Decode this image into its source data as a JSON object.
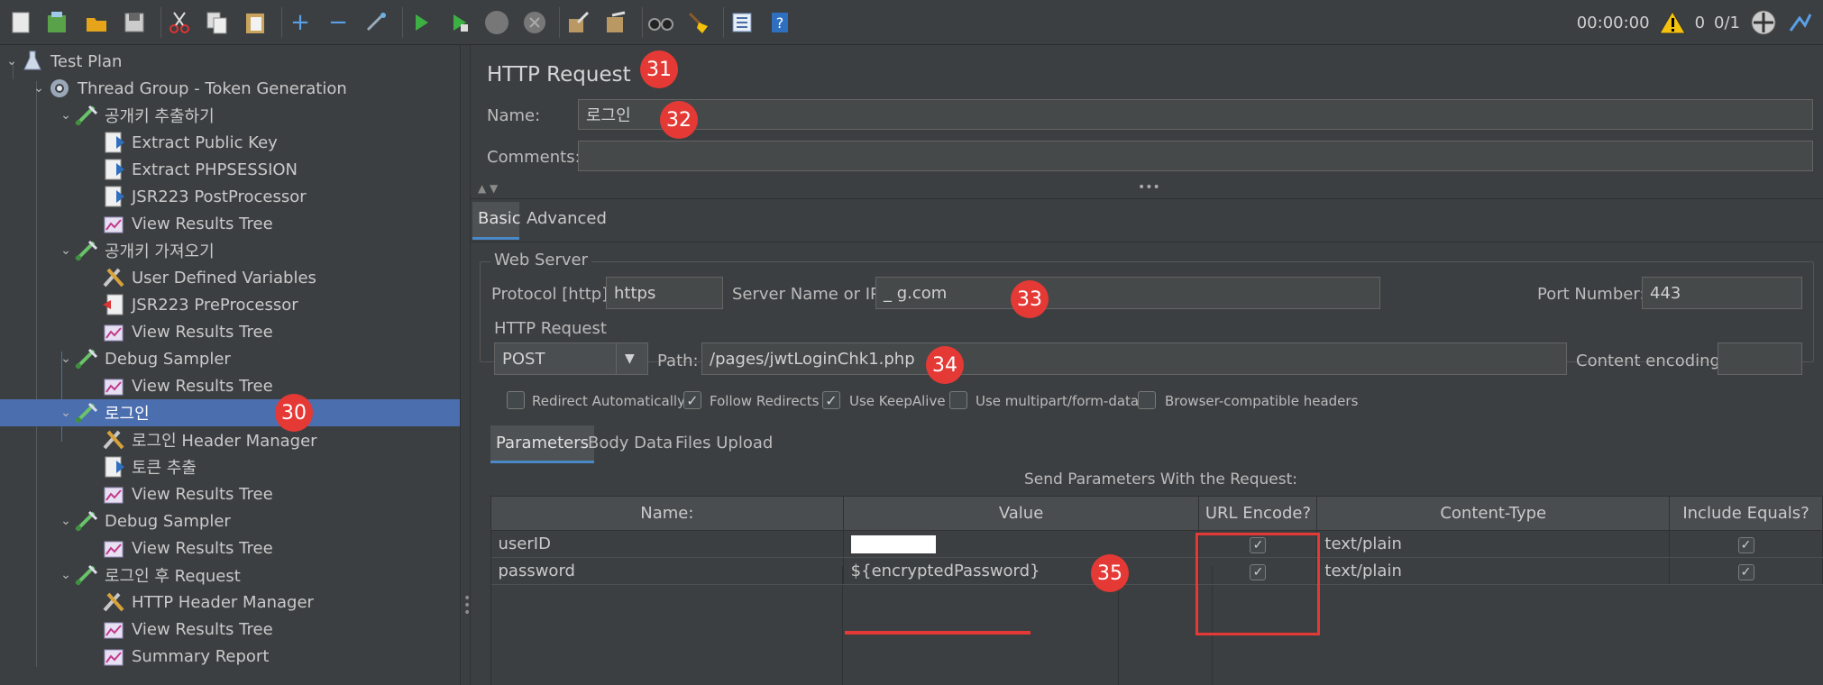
{
  "toolbar": {
    "icons": [
      "new-icon",
      "templates-icon",
      "open-icon",
      "save-icon",
      "cut-icon",
      "copy-icon",
      "paste-icon",
      "expand-icon",
      "collapse-icon",
      "toggle-icon",
      "start-icon",
      "start-no-pause-icon",
      "stop-icon",
      "shutdown-icon",
      "clear-icon",
      "clear-all-icon",
      "search-icon",
      "reset-search-icon",
      "function-helper-icon",
      "help-icon"
    ],
    "timer": "00:00:00",
    "warnings": "0",
    "threads": "0/1"
  },
  "tree": {
    "items": [
      {
        "label": "Test Plan",
        "icon": "test-plan-icon"
      },
      {
        "label": "Thread Group - Token Generation",
        "icon": "gear-icon"
      },
      {
        "label": "공개키 추출하기",
        "icon": "sampler-icon"
      },
      {
        "label": "Extract Public Key",
        "icon": "extractor-icon"
      },
      {
        "label": "Extract PHPSESSION",
        "icon": "extractor-icon"
      },
      {
        "label": "JSR223 PostProcessor",
        "icon": "postprocessor-icon"
      },
      {
        "label": "View Results Tree",
        "icon": "listener-icon"
      },
      {
        "label": "공개키 가져오기",
        "icon": "sampler-icon"
      },
      {
        "label": "User Defined Variables",
        "icon": "config-icon"
      },
      {
        "label": "JSR223 PreProcessor",
        "icon": "preprocessor-icon"
      },
      {
        "label": "View Results Tree",
        "icon": "listener-icon"
      },
      {
        "label": "Debug Sampler",
        "icon": "sampler-icon"
      },
      {
        "label": "View Results Tree",
        "icon": "listener-icon"
      },
      {
        "label": "로그인",
        "icon": "sampler-icon"
      },
      {
        "label": "로그인 Header Manager",
        "icon": "config-icon"
      },
      {
        "label": "토큰 추출",
        "icon": "extractor-icon"
      },
      {
        "label": "View Results Tree",
        "icon": "listener-icon"
      },
      {
        "label": "Debug Sampler",
        "icon": "sampler-icon"
      },
      {
        "label": "View Results Tree",
        "icon": "listener-icon"
      },
      {
        "label": "로그인 후 Request",
        "icon": "sampler-icon"
      },
      {
        "label": "HTTP Header Manager",
        "icon": "config-icon"
      },
      {
        "label": "View Results Tree",
        "icon": "listener-icon"
      },
      {
        "label": "Summary Report",
        "icon": "listener-icon"
      }
    ]
  },
  "annotations": {
    "b30": "30",
    "b31": "31",
    "b32": "32",
    "b33": "33",
    "b34": "34",
    "b35": "35"
  },
  "panel": {
    "title": "HTTP Request",
    "name_label": "Name:",
    "name_value": "로그인",
    "comments_label": "Comments:",
    "comments_value": "",
    "tabs": [
      "Basic",
      "Advanced"
    ],
    "web_server": {
      "legend": "Web Server",
      "protocol_label": "Protocol [http]:",
      "protocol_value": "https",
      "server_label": "Server Name or IP:",
      "server_value": "_          g.com",
      "port_label": "Port Number:",
      "port_value": "443"
    },
    "http_request": {
      "legend": "HTTP Request",
      "method": "POST",
      "path_label": "Path:",
      "path_value": "/pages/jwtLoginChk1.php",
      "encoding_label": "Content encoding:",
      "encoding_value": ""
    },
    "options": [
      {
        "label": "Redirect Automatically",
        "checked": false
      },
      {
        "label": "Follow Redirects",
        "checked": true
      },
      {
        "label": "Use KeepAlive",
        "checked": true
      },
      {
        "label": "Use multipart/form-data",
        "checked": false
      },
      {
        "label": "Browser-compatible headers",
        "checked": false
      }
    ],
    "subtabs": [
      "Parameters",
      "Body Data",
      "Files Upload"
    ],
    "params_caption": "Send Parameters With the Request:",
    "columns": [
      "Name:",
      "Value",
      "URL Encode?",
      "Content-Type",
      "Include Equals?"
    ],
    "rows": [
      {
        "name": "userID",
        "value": "",
        "url_encode": true,
        "content_type": "text/plain",
        "include_equals": true
      },
      {
        "name": "password",
        "value": "${encryptedPassword}",
        "url_encode": true,
        "content_type": "text/plain",
        "include_equals": true
      }
    ],
    "colors": {
      "highlight_red": "#e53935",
      "selection": "#4b6eaf"
    }
  }
}
